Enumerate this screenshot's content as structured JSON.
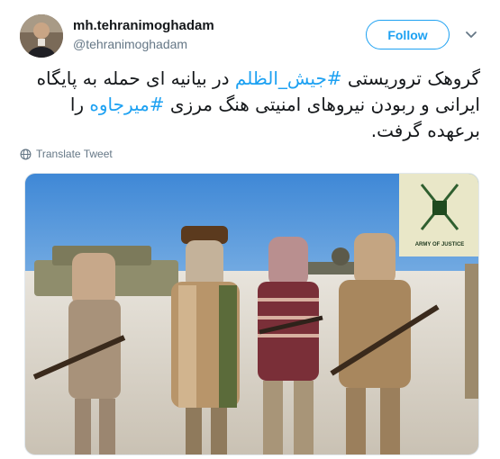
{
  "author": {
    "display_name": "mh.tehranimoghadam",
    "handle": "@tehranimoghadam"
  },
  "actions": {
    "follow_label": "Follow"
  },
  "tweet": {
    "segments": [
      {
        "text": "گروهک تروریستی ",
        "hashtag": false
      },
      {
        "text": "#جیش_الظلم",
        "hashtag": true
      },
      {
        "text": " در بیانیه ای حمله به پایگاه",
        "hashtag": false
      },
      {
        "text": "ایرانی و ربودن نیروهای امنیتی هنگ مرزی ",
        "hashtag": false
      },
      {
        "text": "#میرجاوه",
        "hashtag": true
      },
      {
        "text": " را",
        "hashtag": false
      },
      {
        "text": "برعهده گرفت.",
        "hashtag": false
      }
    ]
  },
  "translate": {
    "label": "Translate Tweet"
  },
  "media": {
    "logo_caption": "ARMY OF JUSTICE"
  },
  "colors": {
    "accent": "#1da1f2",
    "secondary_text": "#657786",
    "primary_text": "#14171a"
  }
}
